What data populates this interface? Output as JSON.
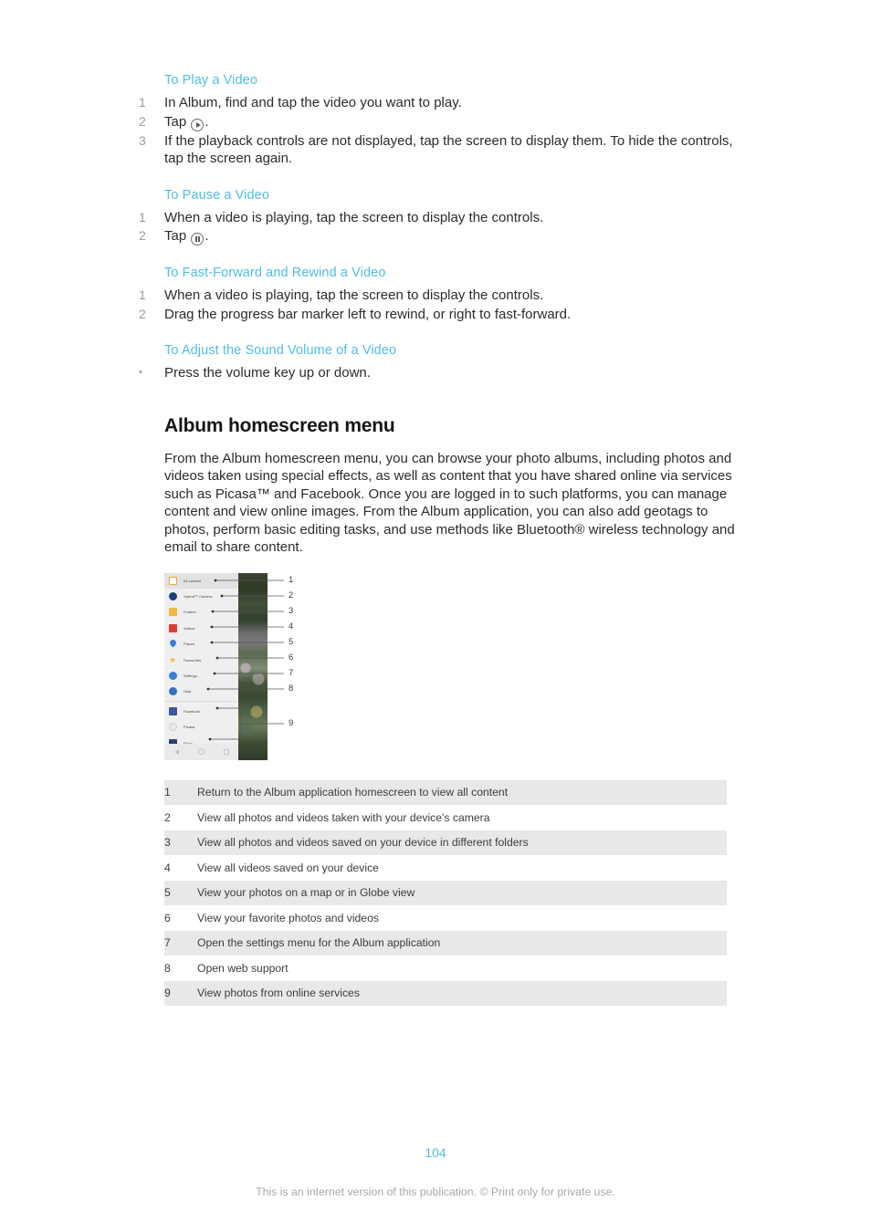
{
  "procedures": [
    {
      "heading": "To Play a Video",
      "type": "ordered",
      "steps": [
        {
          "text": "In Album, find and tap the video you want to play."
        },
        {
          "pre": "Tap ",
          "icon": "play-icon",
          "post": "."
        },
        {
          "text": "If the playback controls are not displayed, tap the screen to display them. To hide the controls, tap the screen again."
        }
      ]
    },
    {
      "heading": "To Pause a Video",
      "type": "ordered",
      "steps": [
        {
          "text": "When a video is playing, tap the screen to display the controls."
        },
        {
          "pre": "Tap ",
          "icon": "pause-icon",
          "post": "."
        }
      ]
    },
    {
      "heading": "To Fast-Forward and Rewind a Video",
      "type": "ordered",
      "steps": [
        {
          "text": "When a video is playing, tap the screen to display the controls."
        },
        {
          "text": "Drag the progress bar marker left to rewind, or right to fast-forward."
        }
      ]
    },
    {
      "heading": "To Adjust the Sound Volume of a Video",
      "type": "bullet",
      "steps": [
        {
          "text": "Press the volume key up or down."
        }
      ]
    }
  ],
  "main": {
    "title": "Album homescreen menu",
    "intro": "From the Album homescreen menu, you can browse your photo albums, including photos and videos taken using special effects, as well as content that you have shared online via services such as Picasa™ and Facebook. Once you are logged in to such platforms, you can manage content and view online images. From the Album application, you can also add geotags to photos, perform basic editing tasks, and use methods like Bluetooth® wireless technology and email to share content."
  },
  "figure": {
    "menu_items": [
      {
        "label": "All content",
        "icon": "all-content-icon",
        "selected": true
      },
      {
        "label": "Xperia™ Camera",
        "icon": "camera-icon",
        "selected": false
      },
      {
        "label": "Folders",
        "icon": "folder-icon",
        "selected": false
      },
      {
        "label": "Videos",
        "icon": "videos-icon",
        "selected": false
      },
      {
        "label": "Places",
        "icon": "places-pin-icon",
        "selected": false
      },
      {
        "label": "Favourites",
        "icon": "star-icon",
        "selected": false
      },
      {
        "label": "Settings",
        "icon": "gear-icon",
        "selected": false
      },
      {
        "label": "Help",
        "icon": "help-icon",
        "selected": false
      },
      {
        "label": "Facebook",
        "icon": "facebook-icon",
        "selected": false
      },
      {
        "label": "Picasa",
        "icon": "picasa-icon",
        "selected": false
      },
      {
        "label": "Flickr",
        "icon": "flickr-icon",
        "selected": false
      }
    ],
    "nav_icons": [
      "back-icon",
      "home-icon",
      "recents-icon"
    ],
    "callout_numbers": [
      "1",
      "2",
      "3",
      "4",
      "5",
      "6",
      "7",
      "8",
      "9"
    ]
  },
  "legend": {
    "rows": [
      {
        "num": "1",
        "desc": "Return to the Album application homescreen to view all content"
      },
      {
        "num": "2",
        "desc": "View all photos and videos taken with your device's camera"
      },
      {
        "num": "3",
        "desc": "View all photos and videos saved on your device in different folders"
      },
      {
        "num": "4",
        "desc": "View all videos saved on your device"
      },
      {
        "num": "5",
        "desc": "View your photos on a map or in Globe view"
      },
      {
        "num": "6",
        "desc": "View your favorite photos and videos"
      },
      {
        "num": "7",
        "desc": "Open the settings menu for the Album application"
      },
      {
        "num": "8",
        "desc": "Open web support"
      },
      {
        "num": "9",
        "desc": "View photos from online services"
      }
    ]
  },
  "footer": {
    "page_number": "104",
    "copyright": "This is an internet version of this publication. © Print only for private use."
  },
  "colors": {
    "heading_blue": "#4fbee8",
    "body_text": "#2b2b2b",
    "row_shade": "#e8e8e8",
    "marker_gray": "#9a9a9a"
  }
}
